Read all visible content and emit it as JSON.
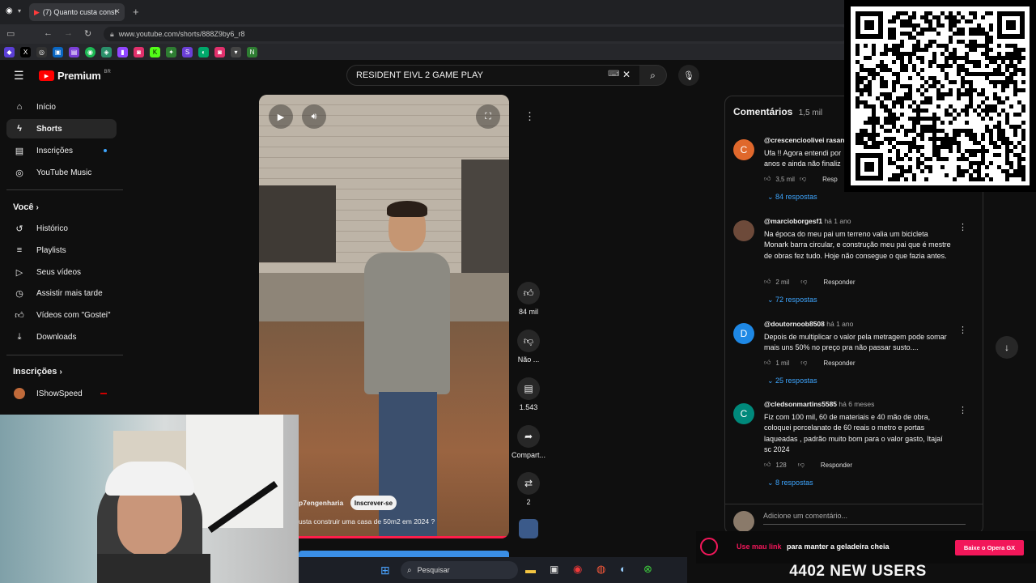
{
  "browser": {
    "tab_title": "(7) Quanto custa const",
    "url": "www.youtube.com/shorts/888Z9by6_r8"
  },
  "header": {
    "logo_text": "Premium",
    "logo_region": "BR",
    "search_value": "RESIDENT EIVL 2 GAME PLAY"
  },
  "sidebar": {
    "items": [
      {
        "label": "Início",
        "icon": "home-icon"
      },
      {
        "label": "Shorts",
        "icon": "shorts-icon"
      },
      {
        "label": "Inscrições",
        "icon": "subscriptions-icon"
      },
      {
        "label": "YouTube Music",
        "icon": "music-icon"
      }
    ],
    "you_heading": "Você",
    "you_items": [
      {
        "label": "Histórico",
        "icon": "history-icon"
      },
      {
        "label": "Playlists",
        "icon": "playlist-icon"
      },
      {
        "label": "Seus vídeos",
        "icon": "video-icon"
      },
      {
        "label": "Assistir mais tarde",
        "icon": "clock-icon"
      },
      {
        "label": "Vídeos com \"Gostei\"",
        "icon": "like-icon"
      },
      {
        "label": "Downloads",
        "icon": "download-icon"
      }
    ],
    "subs_heading": "Inscrições",
    "subs": [
      {
        "label": "IShowSpeed"
      }
    ]
  },
  "short": {
    "channel": "p7engenharia",
    "subscribe_label": "Inscrever-se",
    "caption": "usta construir uma casa de 50m2 em 2024 ?",
    "likes": "84 mil",
    "dislike_label": "Não ...",
    "comments_count": "1.543",
    "share_label": "Compart...",
    "remix_count": "2"
  },
  "comments": {
    "title": "Comentários",
    "count": "1,5 mil",
    "reply_label": "Responder",
    "items": [
      {
        "avatar": "C",
        "avatar_color": "#e0682c",
        "user": "@crescencioolivei rasanto",
        "time": "",
        "text": "Ufa !! Agora entendi por anos e ainda não finaliz",
        "likes": "3,5 mil",
        "reply": "Resp",
        "replies": "84 respostas"
      },
      {
        "avatar": "",
        "avatar_color": "#6d4a3a",
        "user": "@marcioborgesf1",
        "time": "há 1 ano",
        "text": "Na época do meu pai um terreno valia um bicicleta Monark barra circular, e construção meu pai que é mestre de obras fez tudo. Hoje não consegue o que fazia antes.",
        "likes": "2 mil",
        "reply": "Responder",
        "replies": "72 respostas"
      },
      {
        "avatar": "D",
        "avatar_color": "#1e88e5",
        "user": "@doutornoob8508",
        "time": "há 1 ano",
        "text": "Depois de multiplicar o valor pela metragem pode somar mais uns 50% no preço pra não passar susto....",
        "likes": "1 mil",
        "reply": "Responder",
        "replies": "25 respostas"
      },
      {
        "avatar": "C",
        "avatar_color": "#00897b",
        "user": "@cledsonmartins5585",
        "time": "há 6 meses",
        "text": "Fiz com 100 mil, 60 de materiais e 40 mão de obra, coloquei porcelanato de 60 reais o metro e portas laqueadas , padrão muito bom para o valor gasto, Itajaí sc 2024",
        "likes": "128",
        "reply": "Responder",
        "replies": "8 respostas"
      }
    ],
    "add_placeholder": "Adicione um comentário..."
  },
  "taskbar": {
    "search_label": "Pesquisar"
  },
  "overlay": {
    "ad_link": "Use mau link",
    "ad_text": "para manter a geladeira cheia",
    "ad_button": "Baixe o Opera GX",
    "new_users": "4402 NEW USERS"
  }
}
